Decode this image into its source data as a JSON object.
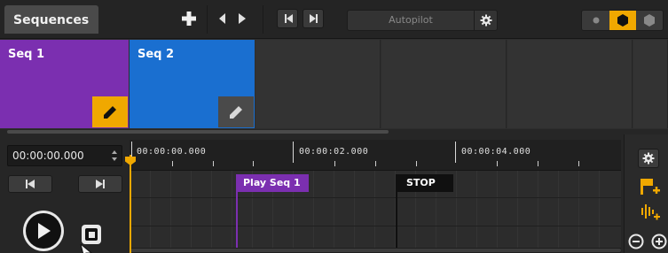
{
  "toolbar": {
    "tab_label": "Sequences",
    "autopilot_label": "Autopilot",
    "icons": [
      "add-icon",
      "prev-icon",
      "next-icon",
      "skip-back-icon",
      "skip-forward-icon",
      "gear-icon"
    ],
    "modes": [
      {
        "name": "dot-mode",
        "active": false
      },
      {
        "name": "hexagon-filled-mode",
        "active": true
      },
      {
        "name": "hexagon-outline-mode",
        "active": false
      }
    ],
    "accent_color": "#f0a800"
  },
  "sequences": [
    {
      "label": "Seq 1",
      "color": "#7b2fb0",
      "edit_active": true
    },
    {
      "label": "Seq 2",
      "color": "#1a6fd0",
      "edit_active": false
    }
  ],
  "transport": {
    "time_value": "00:00:00.000",
    "icons": [
      "skip-back-icon",
      "skip-forward-icon",
      "play-icon",
      "stop-icon"
    ]
  },
  "timeline": {
    "ruler_labels": [
      "00:00:00.000",
      "00:00:02.000",
      "00:00:04.000"
    ],
    "clips": [
      {
        "label": "Play Seq 1",
        "color": "#7b2fb0"
      },
      {
        "label": "STOP",
        "color": "#101010"
      }
    ]
  },
  "side_tools": {
    "icons": [
      "gear-icon",
      "add-flag-icon",
      "add-audio-icon",
      "zoom-out-icon",
      "zoom-in-icon"
    ]
  }
}
